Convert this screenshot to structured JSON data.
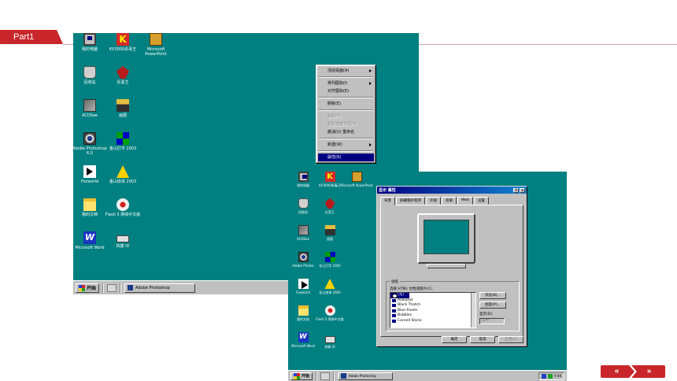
{
  "header": {
    "part_label": "Part1"
  },
  "desktop1": {
    "icons": [
      {
        "label": "我的电脑",
        "glyph": "computer",
        "col": 0,
        "row": 0
      },
      {
        "label": "KV3000杀毒王",
        "glyph": "k",
        "col": 1,
        "row": 0
      },
      {
        "label": "Microsoft PowerPoint",
        "glyph": "ppt",
        "col": 2,
        "row": 0
      },
      {
        "label": "回收站",
        "glyph": "bin",
        "col": 0,
        "row": 1
      },
      {
        "label": "反黑王",
        "glyph": "red",
        "col": 1,
        "row": 1
      },
      {
        "label": "ACDSee",
        "glyph": "acdsee",
        "col": 0,
        "row": 2
      },
      {
        "label": "画图",
        "glyph": "paint",
        "col": 1,
        "row": 2
      },
      {
        "label": "Adobe Photoshop 6.0",
        "glyph": "eye",
        "col": 0,
        "row": 3
      },
      {
        "label": "金山打字 2003",
        "glyph": "tiles",
        "col": 1,
        "row": 3
      },
      {
        "label": "Foxworld",
        "glyph": "arrow",
        "col": 0,
        "row": 4
      },
      {
        "label": "金山快译 2003",
        "glyph": "pyramid",
        "col": 1,
        "row": 4
      },
      {
        "label": "我的文档",
        "glyph": "folder",
        "col": 0,
        "row": 5
      },
      {
        "label": "Flash 5 简体中文版",
        "glyph": "flash",
        "col": 1,
        "row": 5
      },
      {
        "label": "Microsoft Word",
        "glyph": "word",
        "col": 0,
        "row": 6
      },
      {
        "label": "快捷 ID",
        "glyph": "shortcut",
        "col": 1,
        "row": 6
      }
    ],
    "taskbar": {
      "start_label": "开始",
      "task_label": "Adobe Photoshop"
    }
  },
  "context_menu": {
    "items": [
      {
        "label": "活动桌面(A)",
        "type": "submenu"
      },
      {
        "type": "separator"
      },
      {
        "label": "排列图标(I)",
        "type": "submenu"
      },
      {
        "label": "对齐图标(E)",
        "type": "normal"
      },
      {
        "type": "separator"
      },
      {
        "label": "刷新(E)",
        "type": "normal"
      },
      {
        "type": "separator"
      },
      {
        "label": "粘贴(P)",
        "type": "disabled"
      },
      {
        "label": "粘贴快捷方式(S)",
        "type": "disabled"
      },
      {
        "label": "撤消(U) 重命名",
        "type": "normal"
      },
      {
        "type": "separator"
      },
      {
        "label": "新建(W)",
        "type": "submenu"
      },
      {
        "type": "separator"
      },
      {
        "label": "属性(R)",
        "type": "selected"
      }
    ]
  },
  "desktop2": {
    "icons": [
      {
        "label": "我的电脑",
        "glyph": "computer",
        "col": 0,
        "row": 0
      },
      {
        "label": "KV3000杀毒王",
        "glyph": "k",
        "col": 1,
        "row": 0
      },
      {
        "label": "Microsoft PowerPoint",
        "glyph": "ppt",
        "col": 2,
        "row": 0
      },
      {
        "label": "回收站",
        "glyph": "bin",
        "col": 0,
        "row": 1
      },
      {
        "label": "反黑王",
        "glyph": "red",
        "col": 1,
        "row": 1
      },
      {
        "label": "ACDSee",
        "glyph": "acdsee",
        "col": 0,
        "row": 2
      },
      {
        "label": "画图",
        "glyph": "paint",
        "col": 1,
        "row": 2
      },
      {
        "label": "Adobe Photos",
        "glyph": "eye",
        "col": 0,
        "row": 3
      },
      {
        "label": "金山打字 2003",
        "glyph": "tiles",
        "col": 1,
        "row": 3
      },
      {
        "label": "Foxworld",
        "glyph": "arrow",
        "col": 0,
        "row": 4
      },
      {
        "label": "金山快译 2003",
        "glyph": "pyramid",
        "col": 1,
        "row": 4
      },
      {
        "label": "我的文档",
        "glyph": "folder",
        "col": 0,
        "row": 5
      },
      {
        "label": "Flash 5 简体中文版",
        "glyph": "flash",
        "col": 1,
        "row": 5
      },
      {
        "label": "Microsoft Word",
        "glyph": "word",
        "col": 0,
        "row": 6
      },
      {
        "label": "快捷 ID",
        "glyph": "shortcut",
        "col": 1,
        "row": 6
      }
    ],
    "taskbar": {
      "start_label": "开始",
      "task_label": "Adobe Photoshop",
      "clock": "9:08"
    }
  },
  "dialog": {
    "title": "显示 属性",
    "title_buttons": [
      "?",
      "×"
    ],
    "tabs": [
      {
        "label": "背景",
        "active": true
      },
      {
        "label": "屏幕保护程序",
        "active": false
      },
      {
        "label": "外观",
        "active": false
      },
      {
        "label": "效果",
        "active": false
      },
      {
        "label": "Web",
        "active": false
      },
      {
        "label": "设置",
        "active": false
      }
    ],
    "wallpaper": {
      "group_label": "墙纸",
      "prompt": "选择 HTML 文档或图片(C):",
      "items": [
        {
          "label": "(无)",
          "selected": true
        },
        {
          "label": "Alakazat",
          "selected": false
        },
        {
          "label": "Black Thatch",
          "selected": false
        },
        {
          "label": "Blue Rivets",
          "selected": false
        },
        {
          "label": "Bubbles",
          "selected": false
        },
        {
          "label": "Carved Stone",
          "selected": false
        }
      ],
      "browse_label": "浏览(B)...",
      "pattern_label": "图案(P)...",
      "display_label": "显示(D):",
      "display_value": "居中"
    },
    "buttons": {
      "ok": "确定",
      "cancel": "取消",
      "apply": "应用(A)"
    }
  },
  "nav": {
    "prev": "«",
    "next": "»"
  }
}
